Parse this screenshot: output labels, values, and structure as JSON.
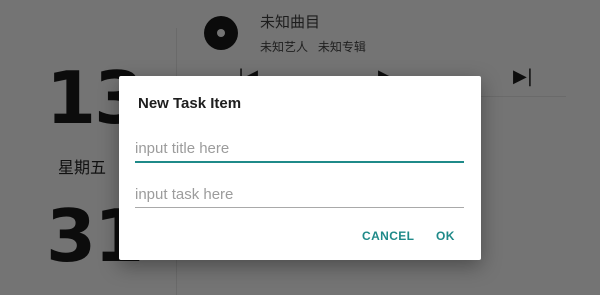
{
  "background": {
    "date_day": "13",
    "weekday": "星期五",
    "year_tail": "31",
    "music": {
      "title": "未知曲目",
      "artist": "未知艺人",
      "album": "未知专辑",
      "prev_icon": "skip-previous-icon",
      "play_icon": "play-icon",
      "next_icon": "skip-next-icon",
      "prev_glyph": "|◀",
      "play_glyph": "▶",
      "next_glyph": "▶|"
    }
  },
  "dialog": {
    "title": "New Task Item",
    "title_placeholder": "input title here",
    "task_placeholder": "input task here",
    "title_value": "",
    "task_value": "",
    "cancel_label": "CANCEL",
    "ok_label": "OK"
  },
  "colors": {
    "scrim_background": "#747474",
    "accent": "#1f8a89",
    "dialog_background": "#ffffff"
  }
}
